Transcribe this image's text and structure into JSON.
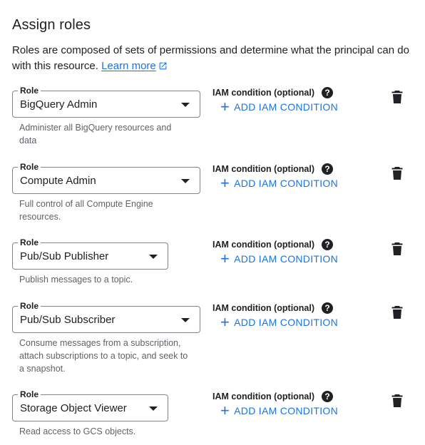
{
  "header": {
    "title": "Assign roles",
    "description": "Roles are composed of sets of permissions and determine what the principal can do with this resource.",
    "learn_more": "Learn more"
  },
  "common": {
    "role_legend": "Role",
    "iam_label": "IAM condition (optional)",
    "help_glyph": "?",
    "add_condition": "ADD IAM CONDITION"
  },
  "roles": [
    {
      "value": "BigQuery Admin",
      "help": "Administer all BigQuery resources and data"
    },
    {
      "value": "Compute Admin",
      "help": "Full control of all Compute Engine resources."
    },
    {
      "value": "Pub/Sub Publisher",
      "help": "Publish messages to a topic."
    },
    {
      "value": "Pub/Sub Subscriber",
      "help": "Consume messages from a subscription, attach subscriptions to a topic, and seek to a snapshot."
    },
    {
      "value": "Storage Object Viewer",
      "help": "Read access to GCS objects."
    }
  ],
  "icons": {
    "help": "help-circle-icon",
    "add": "plus-icon",
    "delete": "trash-icon",
    "external": "open-in-new-icon",
    "dropdown": "caret-down-icon"
  },
  "colors": {
    "accent": "#1a73e8",
    "text": "#202124",
    "secondary_text": "#5f6368",
    "border": "#80868b"
  }
}
